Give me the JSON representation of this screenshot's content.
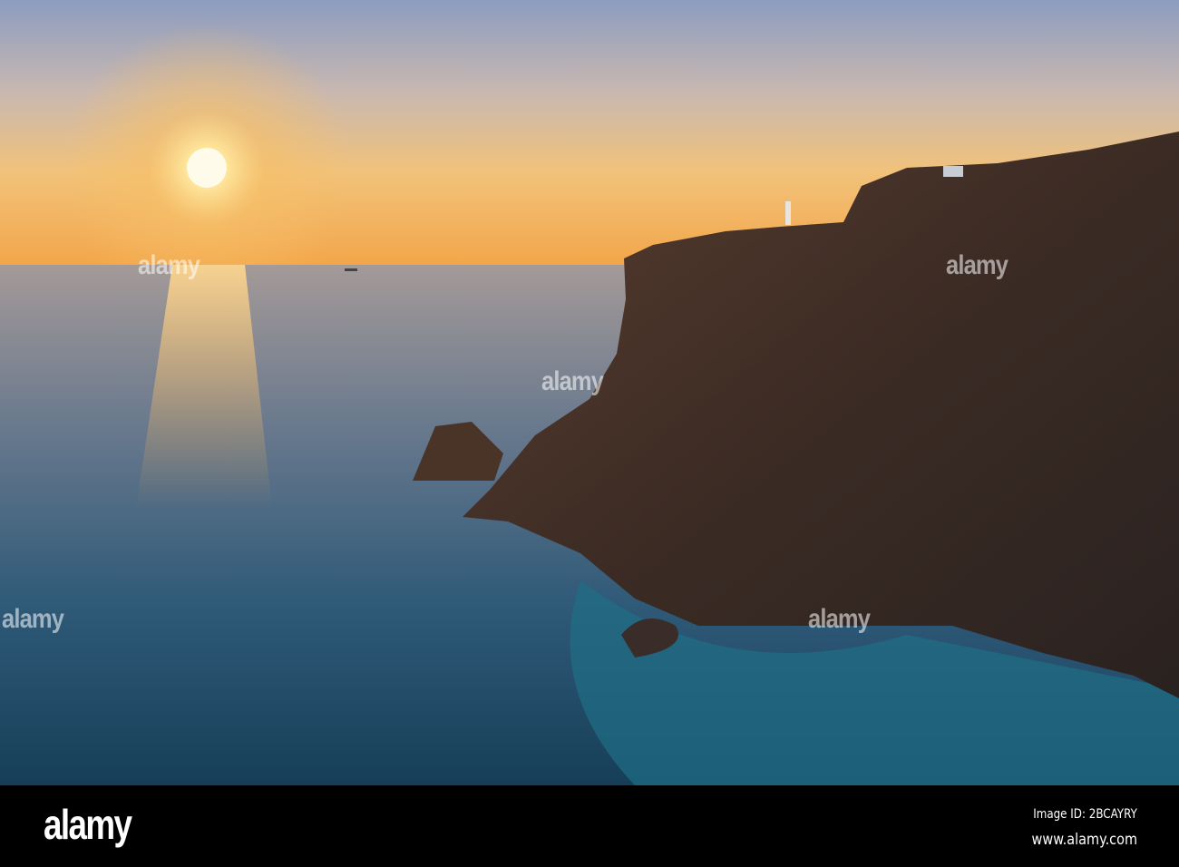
{
  "photo": {
    "subject": "sunset-over-sea-with-cliff-and-lighthouse",
    "watermark_text": "alamy",
    "colors": {
      "sky_top": "#8f9fc0",
      "sky_horizon": "#f2b45a",
      "sun": "#fff6d0",
      "sea_far": "#8a8fa0",
      "sea_near": "#1b4a66",
      "cliff": "#3a2a22"
    }
  },
  "footer": {
    "logo": "alamy",
    "image_id": "Image ID: 2BCAYRY",
    "website": "www.alamy.com"
  }
}
